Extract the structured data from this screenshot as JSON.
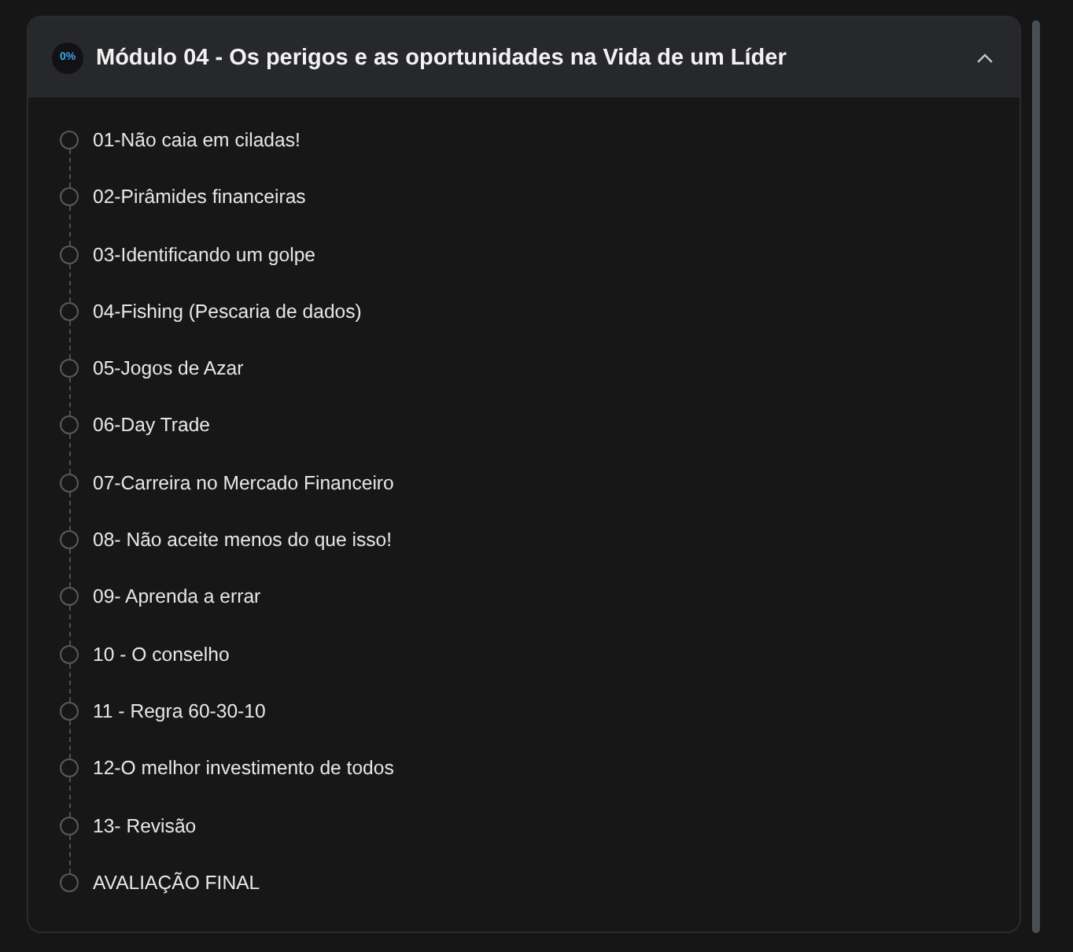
{
  "module": {
    "progress": "0%",
    "title": "Módulo 04 - Os perigos e as oportunidades na Vida de um Líder",
    "expanded": true,
    "lessons": [
      {
        "title": "01-Não caia em ciladas!",
        "completed": false
      },
      {
        "title": "02-Pirâmides financeiras",
        "completed": false
      },
      {
        "title": "03-Identificando um golpe",
        "completed": false
      },
      {
        "title": "04-Fishing (Pescaria de dados)",
        "completed": false
      },
      {
        "title": "05-Jogos de Azar",
        "completed": false
      },
      {
        "title": "06-Day Trade",
        "completed": false
      },
      {
        "title": "07-Carreira no Mercado Financeiro",
        "completed": false
      },
      {
        "title": "08- Não aceite menos do que isso!",
        "completed": false
      },
      {
        "title": "09- Aprenda a errar",
        "completed": false
      },
      {
        "title": "10 - O conselho",
        "completed": false
      },
      {
        "title": "11 - Regra 60-30-10",
        "completed": false
      },
      {
        "title": "12-O melhor investimento de todos",
        "completed": false
      },
      {
        "title": "13- Revisão",
        "completed": false
      },
      {
        "title": "AVALIAÇÃO FINAL",
        "completed": false
      }
    ]
  }
}
